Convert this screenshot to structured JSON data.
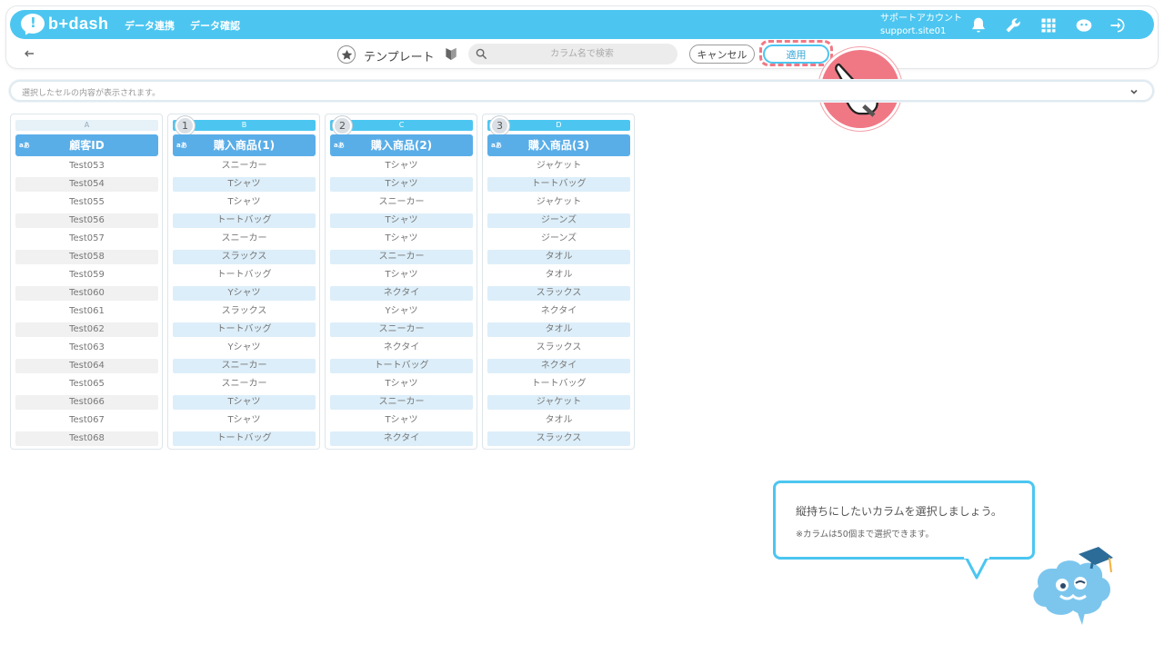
{
  "app": {
    "brand": "b+dash"
  },
  "nav": {
    "links": [
      "データ連携",
      "データ確認"
    ],
    "account_name": "サポートアカウント",
    "account_id": "support.site01"
  },
  "toolbar": {
    "title": "テンプレート",
    "search_placeholder": "カラム名で検索",
    "cancel_label": "キャンセル",
    "apply_label": "適用"
  },
  "cell_bar": {
    "placeholder": "選択したセルの内容が表示されます。"
  },
  "columns": [
    {
      "letter": "A",
      "type": "aあ",
      "header": "顧客ID",
      "order": "",
      "rows": [
        "Test053",
        "Test054",
        "Test055",
        "Test056",
        "Test057",
        "Test058",
        "Test059",
        "Test060",
        "Test061",
        "Test062",
        "Test063",
        "Test064",
        "Test065",
        "Test066",
        "Test067",
        "Test068"
      ]
    },
    {
      "letter": "B",
      "type": "aあ",
      "header": "購入商品(1)",
      "order": "1",
      "rows": [
        "スニーカー",
        "Tシャツ",
        "Tシャツ",
        "トートバッグ",
        "スニーカー",
        "スラックス",
        "トートバッグ",
        "Yシャツ",
        "スラックス",
        "トートバッグ",
        "Yシャツ",
        "スニーカー",
        "スニーカー",
        "Tシャツ",
        "Tシャツ",
        "トートバッグ"
      ]
    },
    {
      "letter": "C",
      "type": "aあ",
      "header": "購入商品(2)",
      "order": "2",
      "rows": [
        "Tシャツ",
        "Tシャツ",
        "スニーカー",
        "Tシャツ",
        "Tシャツ",
        "スニーカー",
        "Tシャツ",
        "ネクタイ",
        "Yシャツ",
        "スニーカー",
        "ネクタイ",
        "トートバッグ",
        "Tシャツ",
        "スニーカー",
        "Tシャツ",
        "ネクタイ"
      ]
    },
    {
      "letter": "D",
      "type": "aあ",
      "header": "購入商品(3)",
      "order": "3",
      "rows": [
        "ジャケット",
        "トートバッグ",
        "ジャケット",
        "ジーンズ",
        "ジーンズ",
        "タオル",
        "タオル",
        "スラックス",
        "ネクタイ",
        "タオル",
        "スラックス",
        "ネクタイ",
        "トートバッグ",
        "ジャケット",
        "タオル",
        "スラックス"
      ]
    }
  ],
  "tooltip": {
    "main": "縦持ちにしたいカラムを選択しましょう。",
    "sub": "※カラムは50個まで選択できます。"
  },
  "colors": {
    "accent": "#4cc6f0",
    "header_blue": "#5aaee8",
    "highlight": "#f07885"
  }
}
